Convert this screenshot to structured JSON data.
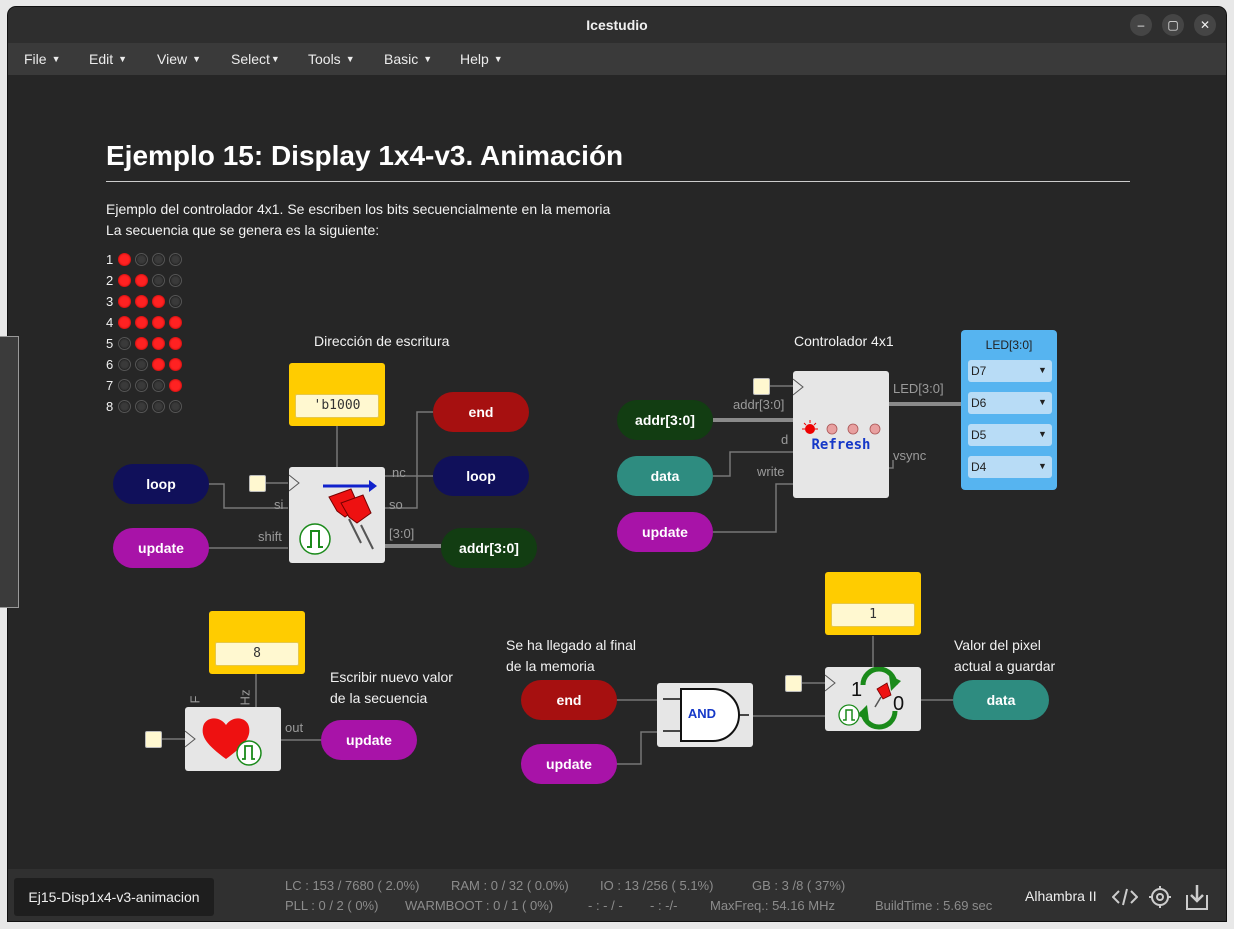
{
  "window": {
    "title": "Icestudio"
  },
  "menu": [
    {
      "label": "File"
    },
    {
      "label": "Edit"
    },
    {
      "label": "View"
    },
    {
      "label": "Select"
    },
    {
      "label": "Tools"
    },
    {
      "label": "Basic"
    },
    {
      "label": "Help"
    }
  ],
  "doc": {
    "heading": "Ejemplo 15: Display 1x4-v3. Animación",
    "desc_line1": "Ejemplo del controlador 4x1. Se escriben los bits secuencialmente en la memoria",
    "desc_line2": "La secuencia que se genera es la siguiente:",
    "sequence": [
      {
        "n": "1",
        "bits": [
          1,
          0,
          0,
          0
        ]
      },
      {
        "n": "2",
        "bits": [
          1,
          1,
          0,
          0
        ]
      },
      {
        "n": "3",
        "bits": [
          1,
          1,
          1,
          0
        ]
      },
      {
        "n": "4",
        "bits": [
          1,
          1,
          1,
          1
        ]
      },
      {
        "n": "5",
        "bits": [
          0,
          1,
          1,
          1
        ]
      },
      {
        "n": "6",
        "bits": [
          0,
          0,
          1,
          1
        ]
      },
      {
        "n": "7",
        "bits": [
          0,
          0,
          0,
          1
        ]
      },
      {
        "n": "8",
        "bits": [
          0,
          0,
          0,
          0
        ]
      }
    ]
  },
  "labels": {
    "direccion": "Dirección de escritura",
    "controlador": "Controlador 4x1",
    "escribir_1": "Escribir nuevo valor",
    "escribir_2": "de la secuencia",
    "final_1": "Se ha llegado al final",
    "final_2": "de la memoria",
    "valor_1": "Valor del pixel",
    "valor_2": "actual a guardar"
  },
  "blocks": {
    "const_b1000": "'b1000",
    "const_8": "8",
    "const_1": "1",
    "refresh_label": "Refresh",
    "and_label": "AND",
    "toggle_1": "1",
    "toggle_0": "0"
  },
  "ports": {
    "nc": "nc",
    "so": "so",
    "si": "si",
    "shift": "shift",
    "bus30": "[3:0]",
    "addr30": "addr[3:0]",
    "d": "d",
    "write": "write",
    "led30": "LED[3:0]",
    "vsync": "vsync",
    "F": "F",
    "Hz": "Hz",
    "out": "out"
  },
  "pills": {
    "loop_in": "loop",
    "update_1": "update",
    "end_out": "end",
    "loop_out": "loop",
    "addr_out": "addr[3:0]",
    "addr_in": "addr[3:0]",
    "data_in": "data",
    "update_2": "update",
    "update_out": "update",
    "end_in": "end",
    "update_3": "update",
    "data_out": "data"
  },
  "led_panel": {
    "title": "LED[3:0]",
    "pins": [
      "D7",
      "D6",
      "D5",
      "D4"
    ]
  },
  "status": {
    "file": "Ej15-Disp1x4-v3-animacion",
    "lc": "LC : 153 / 7680 ( 2.0%)",
    "ram": "RAM : 0 / 32 ( 0.0%)",
    "io": "IO : 13 /256 ( 5.1%)",
    "gb": "GB : 3 /8 ( 37%)",
    "pll": "PLL : 0 / 2 ( 0%)",
    "warmboot": "WARMBOOT : 0 / 1 ( 0%)",
    "dash1": "- : - / -",
    "dash2": "- : -/-",
    "maxfreq": "MaxFreq.: 54.16 MHz",
    "buildtime": "BuildTime : 5.69 sec",
    "board": "Alhambra II"
  },
  "colors": {
    "navy": "#10105a",
    "purple": "#a813a8",
    "darkred": "#a61010",
    "darkgreen": "#123d12",
    "teal": "#2e8c80",
    "yellow": "#ffcc00",
    "led_blue": "#56b4f0"
  }
}
